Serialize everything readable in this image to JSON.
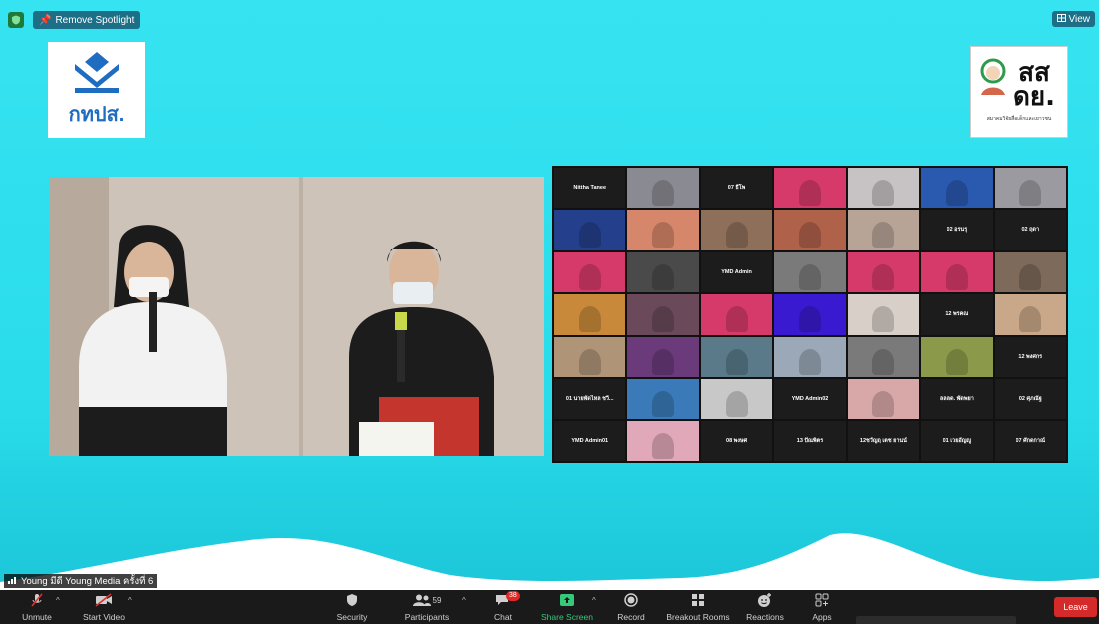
{
  "topbar": {
    "spotlight_label": "Remove Spotlight",
    "view_label": "View"
  },
  "logos": {
    "left_text": "กทปส.",
    "right_text_line1": "สส",
    "right_text_line2": "ดย.",
    "right_caption": "สมาคมวิจัยสื่อเด็กและเยาวชน"
  },
  "gallery": {
    "tiles": [
      {
        "name": "Nittha Tanee",
        "cam": false
      },
      {
        "name": "",
        "cam": true,
        "color": "#8a8a92"
      },
      {
        "name": "07 ธีโพ",
        "cam": false
      },
      {
        "name": "",
        "cam": true,
        "color": "#d63a6a"
      },
      {
        "name": "",
        "cam": true,
        "color": "#c7c2c4"
      },
      {
        "name": "",
        "cam": true,
        "color": "#2a5ab0"
      },
      {
        "name": "",
        "cam": true,
        "color": "#9a9aa0"
      },
      {
        "name": "",
        "cam": true,
        "color": "#243f8c"
      },
      {
        "name": "",
        "cam": true,
        "color": "#d6866a"
      },
      {
        "name": "",
        "cam": true,
        "color": "#8e6f5a"
      },
      {
        "name": "",
        "cam": true,
        "color": "#b0614a"
      },
      {
        "name": "",
        "cam": true,
        "color": "#b7a497"
      },
      {
        "name": "02 อรนรุ",
        "cam": false
      },
      {
        "name": "02 ฤดา",
        "cam": false
      },
      {
        "name": "",
        "cam": true,
        "color": "#d63a6a"
      },
      {
        "name": "",
        "cam": true,
        "color": "#4a4a4a"
      },
      {
        "name": "YMD Admin",
        "cam": false
      },
      {
        "name": "",
        "cam": true,
        "color": "#7a7a7a"
      },
      {
        "name": "",
        "cam": true,
        "color": "#d63a6a"
      },
      {
        "name": "",
        "cam": true,
        "color": "#d63a6a"
      },
      {
        "name": "",
        "cam": true,
        "color": "#7d6a5a"
      },
      {
        "name": "",
        "cam": true,
        "color": "#c88a3a"
      },
      {
        "name": "",
        "cam": true,
        "color": "#6a4a5a"
      },
      {
        "name": "",
        "cam": true,
        "color": "#d63a6a"
      },
      {
        "name": "",
        "cam": true,
        "color": "#3a1ad0"
      },
      {
        "name": "",
        "cam": true,
        "color": "#d8cfc8"
      },
      {
        "name": "12 พรคณ",
        "cam": false
      },
      {
        "name": "",
        "cam": true,
        "color": "#c8a888"
      },
      {
        "name": "",
        "cam": true,
        "color": "#b09478"
      },
      {
        "name": "",
        "cam": true,
        "color": "#6a3a7a"
      },
      {
        "name": "",
        "cam": true,
        "color": "#5a7a8a"
      },
      {
        "name": "",
        "cam": true,
        "color": "#9aa8b8"
      },
      {
        "name": "",
        "cam": true,
        "color": "#7a7a7a"
      },
      {
        "name": "",
        "cam": true,
        "color": "#8a9a4a"
      },
      {
        "name": "12 พงศกร",
        "cam": false
      },
      {
        "name": "01 นายพัดไหล ชวี...",
        "cam": false
      },
      {
        "name": "",
        "cam": true,
        "color": "#3a7ab8"
      },
      {
        "name": "",
        "cam": true,
        "color": "#c8c8c8"
      },
      {
        "name": "YMD Admin02",
        "cam": false
      },
      {
        "name": "",
        "cam": true,
        "color": "#d8a8a8"
      },
      {
        "name": "ลลลด. พัดพยา",
        "cam": false
      },
      {
        "name": "02 ศุภณัฐ",
        "cam": false
      },
      {
        "name": "YMD Admin01",
        "cam": false
      },
      {
        "name": "",
        "cam": true,
        "color": "#e0a8b8"
      },
      {
        "name": "08 พงษศ",
        "cam": false
      },
      {
        "name": "13 ปัณพิตร",
        "cam": false
      },
      {
        "name": "12ชวัญฤ เตช ยานน์",
        "cam": false
      },
      {
        "name": "01 เวยอัญญู",
        "cam": false
      },
      {
        "name": "07 ศักดกาณ์",
        "cam": false
      }
    ]
  },
  "speaker": {
    "name": "Young มีดี Young Media ครั้งที่ 6"
  },
  "toolbar": {
    "unmute": "Unmute",
    "start_video": "Start Video",
    "security": "Security",
    "participants": "Participants",
    "participants_count": "59",
    "chat": "Chat",
    "chat_badge": "38",
    "share_screen": "Share Screen",
    "record": "Record",
    "breakout_rooms": "Breakout Rooms",
    "reactions": "Reactions",
    "apps": "Apps",
    "leave": "Leave"
  },
  "colors": {
    "background": "#2ee0ee",
    "toolbar": "#1a1a1a",
    "leave": "#d42a2a",
    "share_green": "#36c97a"
  }
}
